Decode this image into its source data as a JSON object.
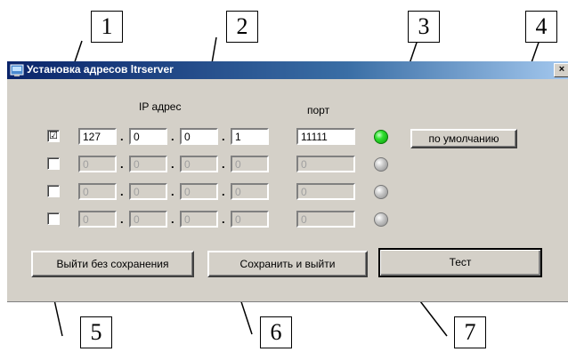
{
  "window": {
    "title": "Установка адресов ltrserver",
    "close_glyph": "×"
  },
  "headers": {
    "ip": "IP адрес",
    "port": "порт"
  },
  "rows": [
    {
      "checked": "☑",
      "ip": [
        "127",
        "0",
        "0",
        "1"
      ],
      "port": "11111",
      "status": "green"
    },
    {
      "checked": "",
      "ip": [
        "0",
        "0",
        "0",
        "0"
      ],
      "port": "0",
      "status": "gray"
    },
    {
      "checked": "",
      "ip": [
        "0",
        "0",
        "0",
        "0"
      ],
      "port": "0",
      "status": "gray"
    },
    {
      "checked": "",
      "ip": [
        "0",
        "0",
        "0",
        "0"
      ],
      "port": "0",
      "status": "gray"
    }
  ],
  "separator": ".",
  "buttons": {
    "default": "по умолчанию",
    "exit_no_save": "Выйти без сохранения",
    "save_exit": "Сохранить и выйти",
    "test": "Тест"
  },
  "callouts": [
    "1",
    "2",
    "3",
    "4",
    "5",
    "6",
    "7"
  ],
  "colors": {
    "title_bar": "#0a246a",
    "dialog_bg": "#d4d0c8",
    "led_on": "#30e030"
  }
}
